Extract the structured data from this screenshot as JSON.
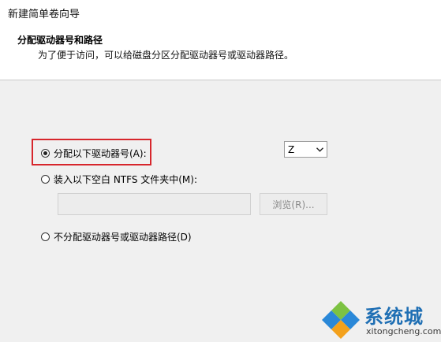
{
  "window": {
    "title": "新建简单卷向导"
  },
  "header": {
    "heading": "分配驱动器号和路径",
    "subheading": "为了便于访问，可以给磁盘分区分配驱动器号或驱动器路径。"
  },
  "options": {
    "assign_letter": {
      "label": "分配以下驱动器号(A):",
      "checked": true
    },
    "mount_folder": {
      "label": "装入以下空白 NTFS 文件夹中(M):",
      "checked": false
    },
    "no_assign": {
      "label": "不分配驱动器号或驱动器路径(D)",
      "checked": false
    }
  },
  "drive_letter": {
    "value": "Z"
  },
  "folder": {
    "path": "",
    "browse_label": "浏览(R)..."
  },
  "watermark": {
    "brand": "系统城",
    "url": "xitongcheng.com"
  },
  "colors": {
    "highlight": "#d7262c",
    "body_bg": "#f0f0f0",
    "brand_blue": "#1f6fb4",
    "logo_green": "#7cc242",
    "logo_blue": "#2a88d8"
  }
}
